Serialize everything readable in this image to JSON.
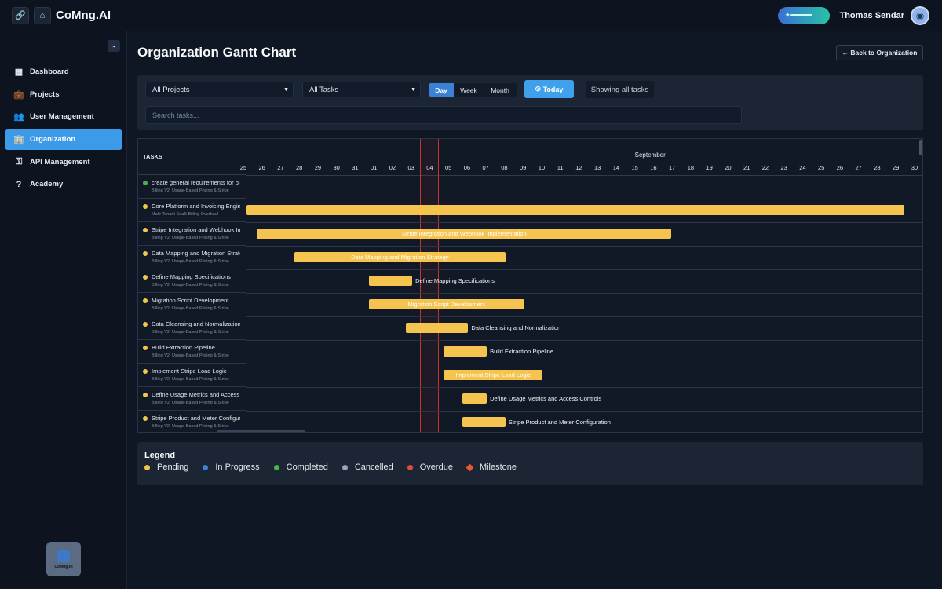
{
  "app": {
    "title": "CoMng.AI",
    "logo_text": "CoMng.AI"
  },
  "topbar": {
    "user_name": "Thomas Sendar"
  },
  "sidebar": {
    "collapse_glyph": "◂",
    "items": [
      {
        "label": "Dashboard",
        "icon": "dashboard-icon",
        "glyph": "▦"
      },
      {
        "label": "Projects",
        "icon": "briefcase-icon",
        "glyph": "💼"
      },
      {
        "label": "User Management",
        "icon": "users-icon",
        "glyph": "👥"
      },
      {
        "label": "Organization",
        "icon": "building-icon",
        "glyph": "🏢",
        "active": true
      },
      {
        "label": "API Management",
        "icon": "key-icon",
        "glyph": "⚿"
      },
      {
        "label": "Academy",
        "icon": "question-icon",
        "glyph": "?"
      }
    ]
  },
  "header": {
    "title": "Organization Gantt Chart",
    "back_label": "Back to Organization"
  },
  "filters": {
    "project_select": "All Projects",
    "task_select": "All Tasks",
    "views": [
      "Day",
      "Week",
      "Month"
    ],
    "active_view": "Day",
    "today_label": "Today",
    "showing": "Showing all tasks",
    "search_placeholder": "Search tasks..."
  },
  "gantt": {
    "tasks_header": "TASKS",
    "month_label": "September",
    "days": [
      "25",
      "26",
      "27",
      "28",
      "29",
      "30",
      "31",
      "01",
      "02",
      "03",
      "04",
      "05",
      "06",
      "07",
      "08",
      "09",
      "10",
      "11",
      "12",
      "13",
      "14",
      "15",
      "16",
      "17",
      "18",
      "19",
      "20",
      "21",
      "22",
      "23",
      "24",
      "25",
      "26",
      "27",
      "28",
      "29",
      "30"
    ],
    "today_day_index": 10,
    "tasks": [
      {
        "name": "create general requirements for billing",
        "sub": "Billing V2: Usage-Based Pricing & Stripe",
        "status": "completed",
        "bar": null
      },
      {
        "name": "Core Platform and Invoicing Engine",
        "sub": "Multi-Tenant SaaS Billing Overhaul",
        "status": "pending",
        "bar": {
          "start": 0,
          "end": 36.3,
          "label": ""
        }
      },
      {
        "name": "Stripe Integration and Webhook Implementation",
        "sub": "Billing V2: Usage-Based Pricing & Stripe",
        "status": "pending",
        "bar": {
          "start": 0.9,
          "end": 23.8,
          "label": "Stripe Integration and Webhook Implementation",
          "pos": "inside"
        }
      },
      {
        "name": "Data Mapping and Migration Strategy",
        "sub": "Billing V2: Usage-Based Pricing & Stripe",
        "status": "pending",
        "bar": {
          "start": 2.9,
          "end": 14.9,
          "label": "Data Mapping and Migration Strategy",
          "pos": "inside"
        }
      },
      {
        "name": "Define Mapping Specifications",
        "sub": "Billing V2: Usage-Based Pricing & Stripe",
        "status": "pending",
        "bar": {
          "start": 6.9,
          "end": 9.9,
          "label": "Define Mapping Specifications",
          "pos": "outside"
        }
      },
      {
        "name": "Migration Script Development",
        "sub": "Billing V2: Usage-Based Pricing & Stripe",
        "status": "pending",
        "bar": {
          "start": 6.9,
          "end": 15.9,
          "label": "Migration Script Development",
          "pos": "inside"
        }
      },
      {
        "name": "Data Cleansing and Normalization",
        "sub": "Billing V2: Usage-Based Pricing & Stripe",
        "status": "pending",
        "bar": {
          "start": 8.9,
          "end": 12.9,
          "label": "Data Cleansing and Normalization",
          "pos": "outside"
        }
      },
      {
        "name": "Build Extraction Pipeline",
        "sub": "Billing V2: Usage-Based Pricing & Stripe",
        "status": "pending",
        "bar": {
          "start": 10.9,
          "end": 13.9,
          "label": "Build Extraction Pipeline",
          "pos": "outside"
        }
      },
      {
        "name": "Implement Stripe Load Logic",
        "sub": "Billing V2: Usage-Based Pricing & Stripe",
        "status": "pending",
        "bar": {
          "start": 10.9,
          "end": 16.9,
          "label": "Implement Stripe Load Logic",
          "pos": "inside"
        }
      },
      {
        "name": "Define Usage Metrics and Access Controls",
        "sub": "Billing V2: Usage-Based Pricing & Stripe",
        "status": "pending",
        "bar": {
          "start": 11.9,
          "end": 13.9,
          "label": "Define Usage Metrics and Access Controls",
          "pos": "outside"
        }
      },
      {
        "name": "Stripe Product and Meter Configuration",
        "sub": "Billing V2: Usage-Based Pricing & Stripe",
        "status": "pending",
        "bar": {
          "start": 11.9,
          "end": 14.9,
          "label": "Stripe Product and Meter Configuration",
          "pos": "outside"
        }
      }
    ]
  },
  "legend": {
    "title": "Legend",
    "items": [
      {
        "label": "Pending",
        "color": "#f5c44e",
        "shape": "dot"
      },
      {
        "label": "In Progress",
        "color": "#3b82d6",
        "shape": "dot"
      },
      {
        "label": "Completed",
        "color": "#4caf50",
        "shape": "dot"
      },
      {
        "label": "Cancelled",
        "color": "#9aa4b2",
        "shape": "dot"
      },
      {
        "label": "Overdue",
        "color": "#e04b3c",
        "shape": "dot"
      },
      {
        "label": "Milestone",
        "color": "#e8552f",
        "shape": "diamond"
      }
    ]
  },
  "status_colors": {
    "pending": "#f5c44e",
    "completed": "#4caf50"
  }
}
